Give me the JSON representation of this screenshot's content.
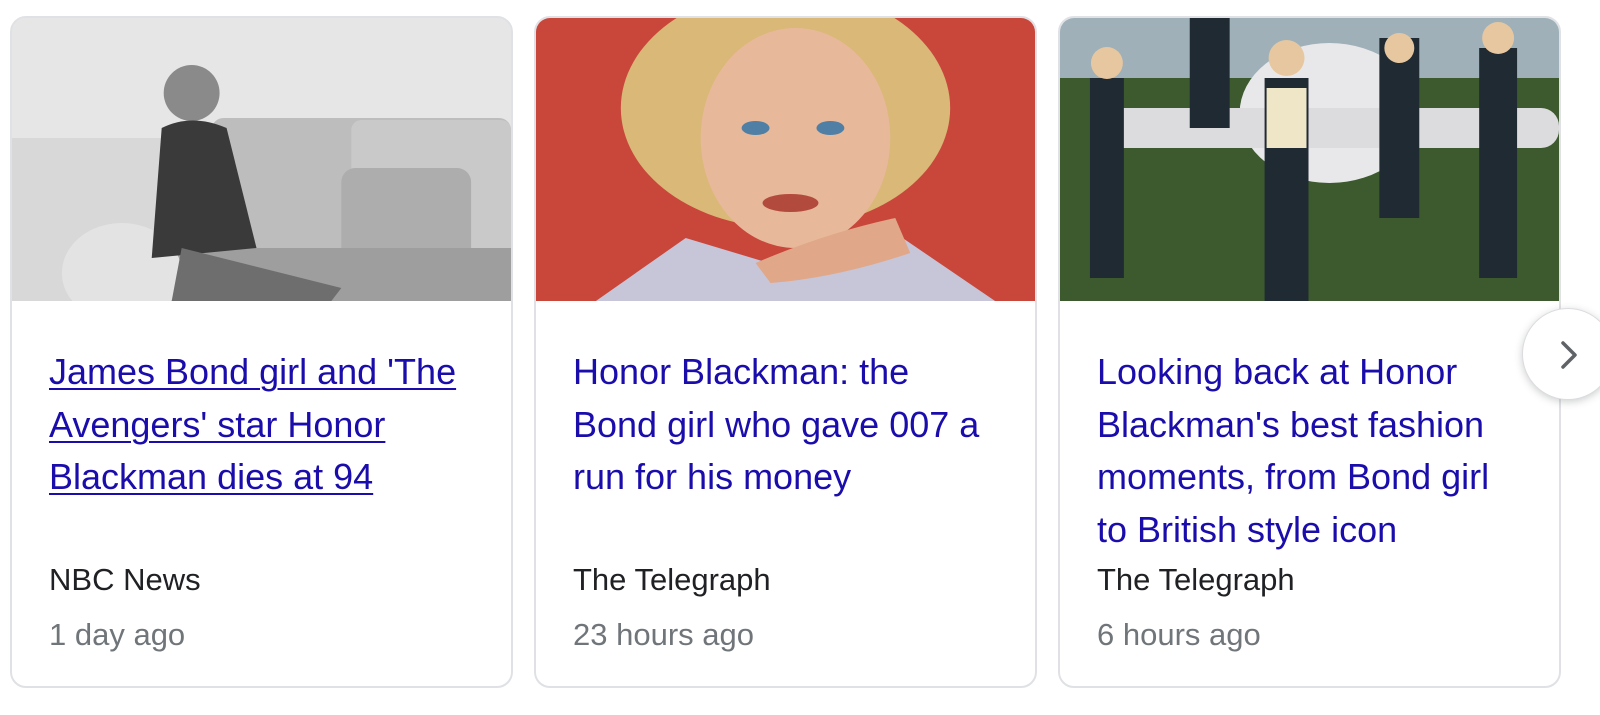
{
  "cards": [
    {
      "headline": "James Bond girl and 'The Avengers' star Honor Blackman dies at 94",
      "source": "NBC News",
      "time": "1 day ago",
      "image": "bw-photo-woman-on-sofa"
    },
    {
      "headline": "Honor Blackman: the Bond girl who gave 007 a run for his money",
      "source": "The Telegraph",
      "time": "23 hours ago",
      "image": "portrait-woman-red-background"
    },
    {
      "headline": "Looking back at Honor Blackman's best fashion moments, from Bond girl to British style icon",
      "source": "The Telegraph",
      "time": "6 hours ago",
      "image": "group-in-front-of-plane"
    }
  ],
  "next_button": {
    "icon": "chevron-right-icon"
  },
  "colors": {
    "link": "#1a0dab",
    "source_text": "#202124",
    "time_text": "#70757a",
    "card_border": "#dfe1e5"
  }
}
